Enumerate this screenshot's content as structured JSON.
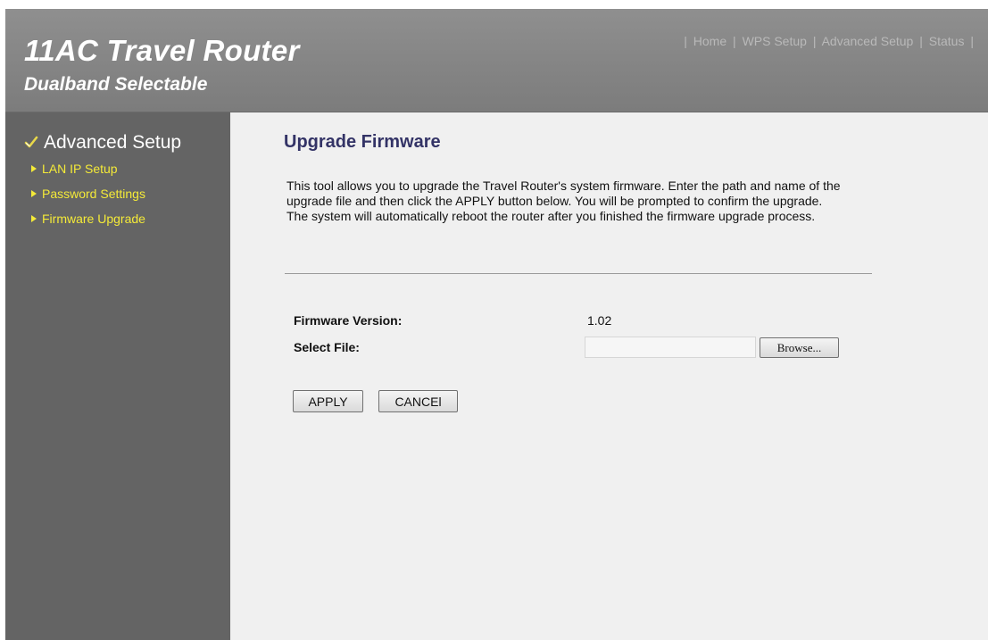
{
  "header": {
    "title": "11AC Travel Router",
    "subtitle": "Dualband Selectable",
    "nav": [
      {
        "label": "Home"
      },
      {
        "label": "WPS Setup"
      },
      {
        "label": "Advanced Setup"
      },
      {
        "label": "Status"
      }
    ]
  },
  "sidebar": {
    "heading": "Advanced Setup",
    "heading_icon": "checkmark-icon",
    "items": [
      {
        "label": "LAN IP Setup",
        "icon": "arrow-right-icon"
      },
      {
        "label": "Password Settings",
        "icon": "arrow-right-icon"
      },
      {
        "label": "Firmware Upgrade",
        "icon": "arrow-right-icon"
      }
    ]
  },
  "main": {
    "title": "Upgrade Firmware",
    "description": [
      "This tool allows you to upgrade the Travel Router's system firmware. Enter the path and name of the upgrade file and then click the APPLY button below. You will be prompted to confirm the upgrade.",
      "The system will automatically reboot the router after you finished the firmware upgrade process."
    ],
    "firmware_version_label": "Firmware Version:",
    "firmware_version_value": "1.02",
    "select_file_label": "Select File:",
    "select_file_value": "",
    "browse_label": "Browse...",
    "apply_label": "APPLY",
    "cancel_label": "CANCEl"
  },
  "colors": {
    "header_bg": "#848484",
    "sidebar_bg": "#646464",
    "main_bg": "#f0f0f0",
    "sidebar_link": "#f4ea38",
    "page_title": "#333366",
    "nav_text": "#b9b9b9"
  }
}
